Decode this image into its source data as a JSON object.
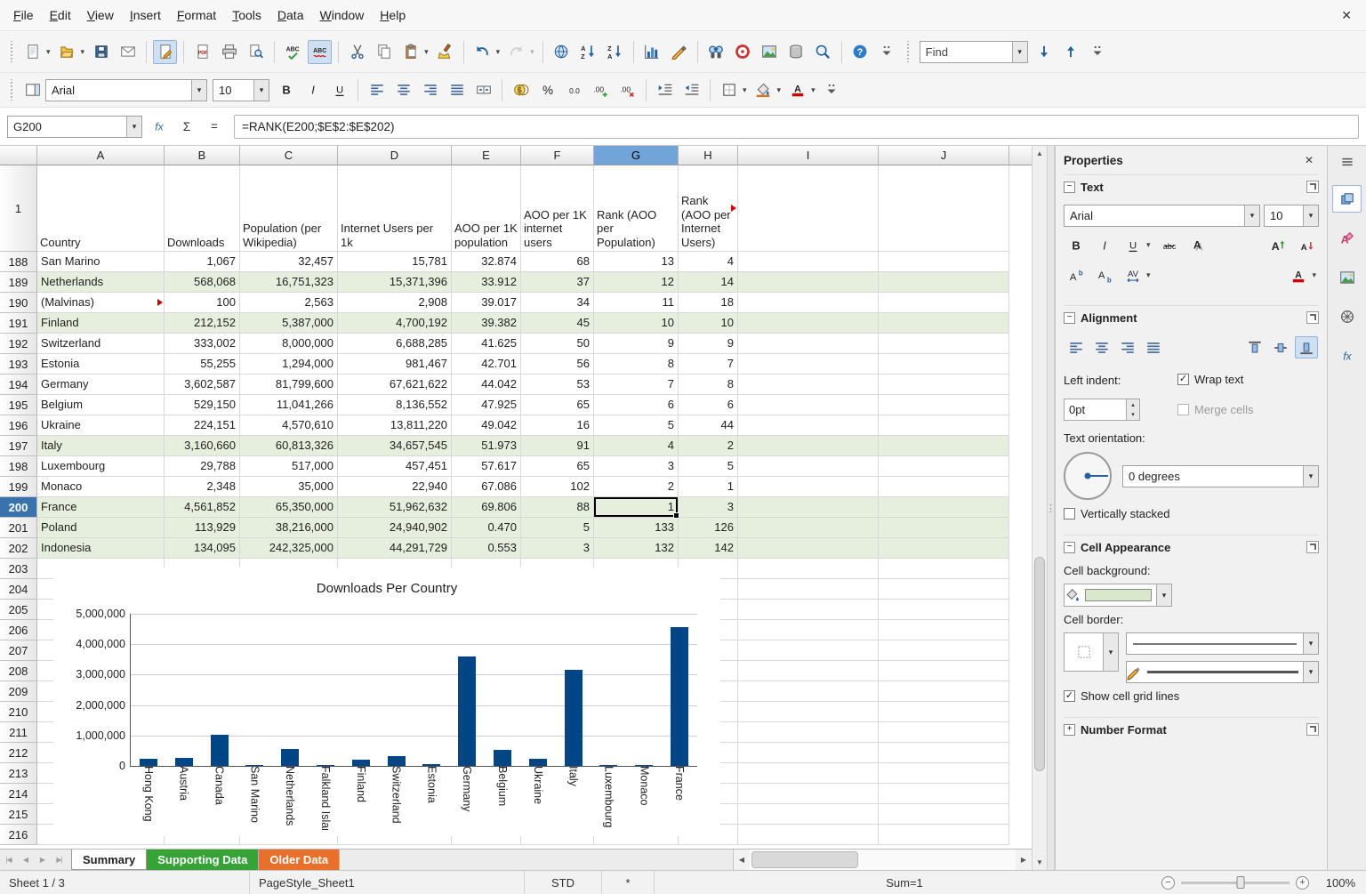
{
  "window": {
    "close": "✕"
  },
  "menubar": {
    "items": [
      "File",
      "Edit",
      "View",
      "Insert",
      "Format",
      "Tools",
      "Data",
      "Window",
      "Help"
    ]
  },
  "toolbars": {
    "standard": [
      {
        "name": "new-document",
        "dropdown": true
      },
      {
        "name": "open",
        "dropdown": true
      },
      {
        "name": "save"
      },
      {
        "name": "send-email"
      },
      {
        "sep": true
      },
      {
        "name": "edit-mode",
        "toggled": true
      },
      {
        "sep": true
      },
      {
        "name": "export-pdf"
      },
      {
        "name": "print"
      },
      {
        "name": "print-preview"
      },
      {
        "sep": true
      },
      {
        "name": "spelling"
      },
      {
        "name": "auto-spellcheck",
        "toggled": true
      },
      {
        "sep": true
      },
      {
        "name": "cut"
      },
      {
        "name": "copy"
      },
      {
        "name": "paste",
        "dropdown": true
      },
      {
        "name": "clone-formatting"
      },
      {
        "sep": true
      },
      {
        "name": "undo",
        "dropdown": true
      },
      {
        "name": "redo",
        "dropdown": true,
        "disabled": true
      },
      {
        "sep": true
      },
      {
        "name": "hyperlink"
      },
      {
        "name": "sort-ascending"
      },
      {
        "name": "sort-descending"
      },
      {
        "sep": true
      },
      {
        "name": "insert-chart"
      },
      {
        "name": "draw-functions"
      },
      {
        "sep": true
      },
      {
        "name": "find-replace"
      },
      {
        "name": "navigator"
      },
      {
        "name": "gallery"
      },
      {
        "name": "data-sources"
      },
      {
        "name": "zoom"
      },
      {
        "sep": true
      },
      {
        "name": "help"
      },
      {
        "name": "overflow"
      }
    ],
    "find": {
      "value": "Find",
      "buttons": [
        {
          "name": "find-next"
        },
        {
          "name": "find-previous"
        },
        {
          "name": "overflow"
        }
      ]
    },
    "formatting": {
      "leading": [
        {
          "name": "sidebar-toggle"
        }
      ],
      "font_name": "Arial",
      "font_size": "10",
      "buttons": [
        {
          "name": "bold"
        },
        {
          "name": "italic"
        },
        {
          "name": "underline"
        },
        {
          "sep": true
        },
        {
          "name": "align-left"
        },
        {
          "name": "align-center"
        },
        {
          "name": "align-right"
        },
        {
          "name": "align-justify"
        },
        {
          "name": "merge-cells"
        },
        {
          "sep": true
        },
        {
          "name": "format-currency"
        },
        {
          "name": "format-percent"
        },
        {
          "name": "format-number"
        },
        {
          "name": "add-decimal"
        },
        {
          "name": "delete-decimal"
        },
        {
          "sep": true
        },
        {
          "name": "increase-indent"
        },
        {
          "name": "decrease-indent"
        },
        {
          "sep": true
        },
        {
          "name": "borders",
          "dropdown": true
        },
        {
          "name": "background-color",
          "dropdown": true
        },
        {
          "name": "font-color",
          "dropdown": true
        },
        {
          "name": "overflow"
        }
      ]
    }
  },
  "formula_bar": {
    "cell_ref": "G200",
    "formula": "=RANK(E200;$E$2:$E$202)"
  },
  "grid": {
    "columns": [
      "A",
      "B",
      "C",
      "D",
      "E",
      "F",
      "G",
      "H",
      "I",
      "J"
    ],
    "selected_column": "G",
    "selected_row": 200,
    "header_row": {
      "n": 1,
      "cells": [
        "Country",
        "Downloads",
        "Population (per Wikipedia)",
        "Internet Users per 1k",
        "AOO per 1K population",
        "AOO per 1K internet users",
        "Rank (AOO per Population)",
        "Rank (AOO per Internet Users)"
      ],
      "overflow_marker_col": "H"
    },
    "rows": [
      {
        "n": 188,
        "cells": [
          "San Marino",
          "1,067",
          "32,457",
          "15,781",
          "32.874",
          "68",
          "13",
          "4"
        ]
      },
      {
        "n": 189,
        "cells": [
          "Netherlands",
          "568,068",
          "16,751,323",
          "15,371,396",
          "33.912",
          "37",
          "12",
          "14"
        ],
        "green": true
      },
      {
        "n": 190,
        "cells": [
          "(Malvinas)",
          "100",
          "2,563",
          "2,908",
          "39.017",
          "34",
          "11",
          "18"
        ],
        "overflow_marker": true
      },
      {
        "n": 191,
        "cells": [
          "Finland",
          "212,152",
          "5,387,000",
          "4,700,192",
          "39.382",
          "45",
          "10",
          "10"
        ],
        "green": true
      },
      {
        "n": 192,
        "cells": [
          "Switzerland",
          "333,002",
          "8,000,000",
          "6,688,285",
          "41.625",
          "50",
          "9",
          "9"
        ]
      },
      {
        "n": 193,
        "cells": [
          "Estonia",
          "55,255",
          "1,294,000",
          "981,467",
          "42.701",
          "56",
          "8",
          "7"
        ]
      },
      {
        "n": 194,
        "cells": [
          "Germany",
          "3,602,587",
          "81,799,600",
          "67,621,622",
          "44.042",
          "53",
          "7",
          "8"
        ]
      },
      {
        "n": 195,
        "cells": [
          "Belgium",
          "529,150",
          "11,041,266",
          "8,136,552",
          "47.925",
          "65",
          "6",
          "6"
        ]
      },
      {
        "n": 196,
        "cells": [
          "Ukraine",
          "224,151",
          "4,570,610",
          "13,811,220",
          "49.042",
          "16",
          "5",
          "44"
        ]
      },
      {
        "n": 197,
        "cells": [
          "Italy",
          "3,160,660",
          "60,813,326",
          "34,657,545",
          "51.973",
          "91",
          "4",
          "2"
        ],
        "green": true
      },
      {
        "n": 198,
        "cells": [
          "Luxembourg",
          "29,788",
          "517,000",
          "457,451",
          "57.617",
          "65",
          "3",
          "5"
        ]
      },
      {
        "n": 199,
        "cells": [
          "Monaco",
          "2,348",
          "35,000",
          "22,940",
          "67.086",
          "102",
          "2",
          "1"
        ]
      },
      {
        "n": 200,
        "cells": [
          "France",
          "4,561,852",
          "65,350,000",
          "51,962,632",
          "69.806",
          "88",
          "1",
          "3"
        ],
        "green": true,
        "selected": true
      },
      {
        "n": 201,
        "cells": [
          "Poland",
          "113,929",
          "38,216,000",
          "24,940,902",
          "0.470",
          "5",
          "133",
          "126"
        ],
        "green": true
      },
      {
        "n": 202,
        "cells": [
          "Indonesia",
          "134,095",
          "242,325,000",
          "44,291,729",
          "0.553",
          "3",
          "132",
          "142"
        ],
        "green": true
      }
    ],
    "empty_rows": [
      203,
      204,
      205,
      206,
      207,
      208,
      209,
      210,
      211,
      212,
      213,
      214,
      215,
      216
    ]
  },
  "chart_data": {
    "type": "bar",
    "title": "Downloads Per Country",
    "categories": [
      "Hong Kong",
      "Austria",
      "Canada",
      "San Marino",
      "Netherlands",
      "Falkland Islands",
      "Finland",
      "Switzerland",
      "Estonia",
      "Germany",
      "Belgium",
      "Ukraine",
      "Italy",
      "Luxembourg",
      "Monaco",
      "France"
    ],
    "values": [
      220000,
      250000,
      1035000,
      1067,
      568068,
      100,
      212152,
      333002,
      55255,
      3602587,
      529150,
      224151,
      3160660,
      29788,
      2348,
      4561852
    ],
    "xlabel": "",
    "ylabel": "",
    "ylim": [
      0,
      5000000
    ],
    "y_ticks": [
      5000000,
      4000000,
      3000000,
      2000000,
      1000000,
      0
    ],
    "y_tick_labels": [
      "5,000,000",
      "4,000,000",
      "3,000,000",
      "2,000,000",
      "1,000,000",
      "0"
    ],
    "bar_color": "#004586",
    "grid": "horizontal",
    "legend": "none"
  },
  "sheet_tabs": {
    "tabs": [
      {
        "label": "Summary",
        "active": true
      },
      {
        "label": "Supporting Data",
        "color": "#35a335",
        "text_color": "#ffffff"
      },
      {
        "label": "Older Data",
        "color": "#e8702a",
        "text_color": "#ffffff"
      }
    ]
  },
  "deck_strip": {
    "decks": [
      {
        "name": "properties",
        "active": true
      },
      {
        "name": "styles"
      },
      {
        "name": "gallery"
      },
      {
        "name": "navigator"
      },
      {
        "name": "functions"
      }
    ]
  },
  "status_bar": {
    "sheet": "Sheet 1 / 3",
    "page_style": "PageStyle_Sheet1",
    "mode": "STD",
    "modified": "*",
    "selection_sum": "Sum=1",
    "zoom": "100%"
  },
  "sidebar": {
    "title": "Properties",
    "text_section": {
      "title": "Text",
      "font_name": "Arial",
      "font_size": "10",
      "buttons_row1": [
        {
          "name": "bold"
        },
        {
          "name": "italic"
        },
        {
          "name": "underline",
          "dropdown": true
        },
        {
          "name": "strikethrough"
        },
        {
          "name": "shadow"
        },
        {
          "gap": true
        },
        {
          "name": "grow-font"
        },
        {
          "name": "shrink-font"
        }
      ],
      "buttons_row2": [
        {
          "name": "superscript"
        },
        {
          "name": "subscript"
        },
        {
          "name": "character-spacing",
          "dropdown": true
        },
        {
          "gap": true
        },
        {
          "name": "font-color",
          "dropdown": true
        }
      ]
    },
    "alignment_section": {
      "title": "Alignment",
      "h_align": [
        {
          "name": "align-left"
        },
        {
          "name": "align-center"
        },
        {
          "name": "align-right"
        },
        {
          "name": "align-justify"
        }
      ],
      "v_align": [
        {
          "name": "align-top"
        },
        {
          "name": "align-vcenter"
        },
        {
          "name": "align-bottom",
          "selected": true
        }
      ],
      "left_indent_label": "Left indent:",
      "left_indent_value": "0pt",
      "wrap_text": {
        "label": "Wrap text",
        "checked": true
      },
      "merge_cells": {
        "label": "Merge cells",
        "checked": false,
        "disabled": true
      },
      "text_orientation_label": "Text orientation:",
      "orientation_value": "0 degrees",
      "vertically_stacked": {
        "label": "Vertically stacked",
        "checked": false
      }
    },
    "cell_appearance_section": {
      "title": "Cell Appearance",
      "background_label": "Cell background:",
      "background_swatch": "#d9e8cb",
      "border_label": "Cell border:",
      "gridlines": {
        "label": "Show cell grid lines",
        "checked": true
      }
    },
    "number_format_section": {
      "title": "Number Format"
    }
  }
}
